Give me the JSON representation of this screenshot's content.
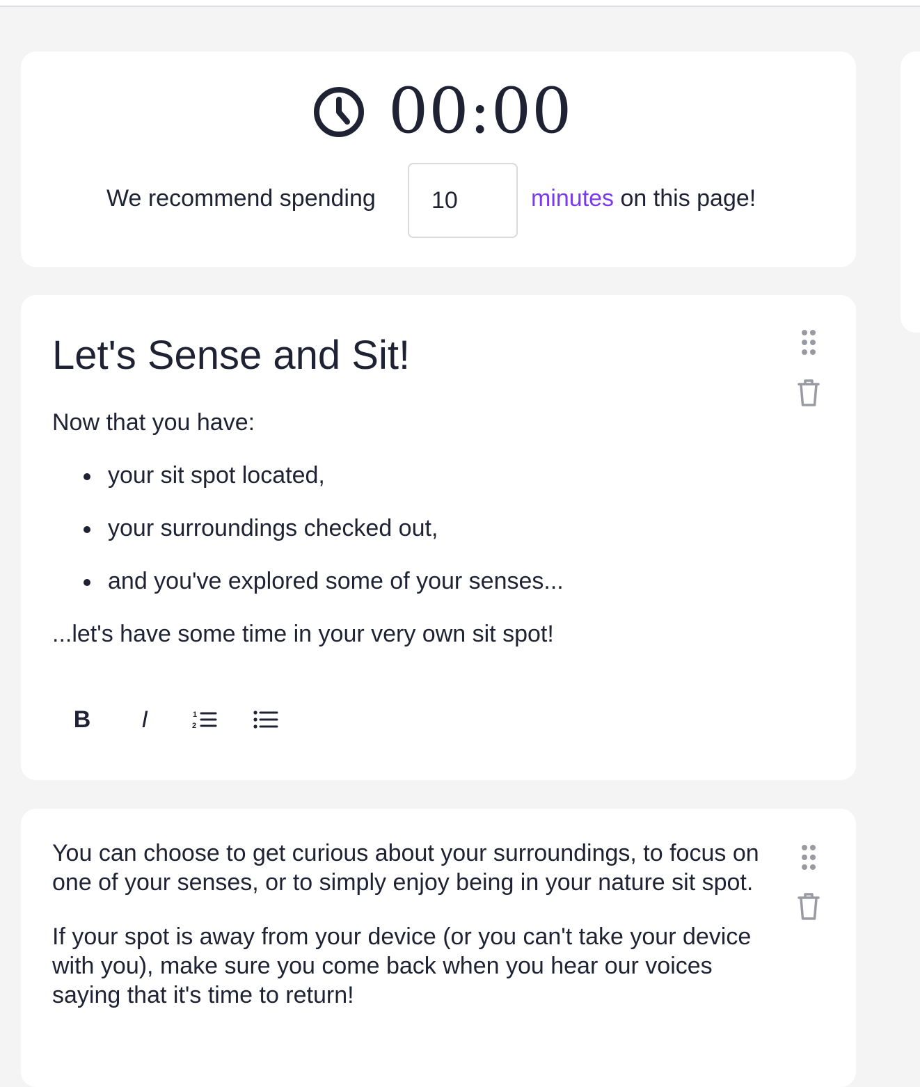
{
  "timer": {
    "display": "00:00",
    "recommend_prefix": "We recommend spending",
    "minutes_value": "10",
    "minutes_link": "minutes",
    "recommend_suffix": "on this page!"
  },
  "blocks": [
    {
      "title": "Let's Sense and Sit!",
      "intro": "Now that you have:",
      "bullets": [
        "your sit spot located,",
        "your surroundings checked out,",
        "and you've explored some of your senses..."
      ],
      "outro": "...let's have some time in your very own sit spot!",
      "toolbar": {
        "bold_label": "B",
        "italic_label": "I"
      }
    },
    {
      "paragraphs": [
        "You can choose to get curious about your surroundings, to focus on one of your senses, or to simply enjoy being in your nature sit spot.",
        "If your spot is away from your device (or you can't take your device with you), make sure you come back when you hear our voices saying that it's time to return!"
      ]
    }
  ],
  "icons": {
    "timer": "clock-icon",
    "drag": "drag-handle-icon",
    "delete": "trash-icon",
    "ordered_list": "ordered-list-icon",
    "unordered_list": "unordered-list-icon"
  },
  "colors": {
    "accent": "#7c3aed",
    "text": "#1f2233",
    "background": "#f4f4f5",
    "muted_icon": "#9a9aa3"
  }
}
